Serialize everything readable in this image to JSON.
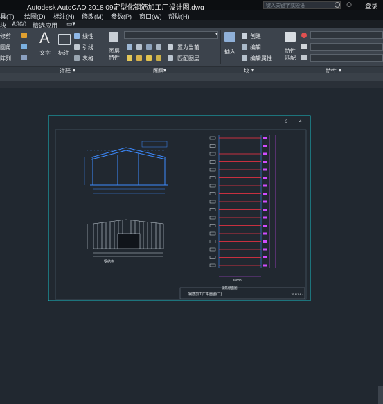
{
  "app": {
    "title": "Autodesk AutoCAD 2018    09定型化钢筋加工厂设计图.dwg",
    "search_placeholder": "键入关键字或短语",
    "login": "登录"
  },
  "menu": [
    "具(T)",
    "绘图(D)",
    "标注(N)",
    "修改(M)",
    "参数(P)",
    "窗口(W)",
    "帮助(H)"
  ],
  "tabs": [
    "块",
    "A360",
    "精选应用"
  ],
  "ribbon": {
    "modify_items": [
      "修剪",
      "圆角",
      "阵列"
    ],
    "text_label": "文字",
    "dim_label": "标注",
    "linear": "线性",
    "leader": "引线",
    "table": "表格",
    "layer_props": "图层\n特性",
    "set_current": "置为当前",
    "match_layer": "匹配图层",
    "insert": "插入",
    "create": "创建",
    "edit": "编辑",
    "edit_attr": "编辑属性",
    "match_props": "特性\n匹配"
  },
  "panels": {
    "annotation": "注释",
    "layers": "图层",
    "block": "块",
    "properties": "特性"
  },
  "drawing": {
    "page_marks": [
      "3",
      "4"
    ],
    "left_label": "钢结构",
    "mid_label": "钢筋棚面图",
    "bottom_dim": "26000",
    "title_block": "钢筋加工厂平面图(二)",
    "code": "JS-RJ-A-4"
  },
  "colors": {
    "frame": "#19c1c9",
    "blue_lines": "#3d8bff",
    "red_lines": "#ff3344",
    "magenta_dims": "#d04cff"
  }
}
